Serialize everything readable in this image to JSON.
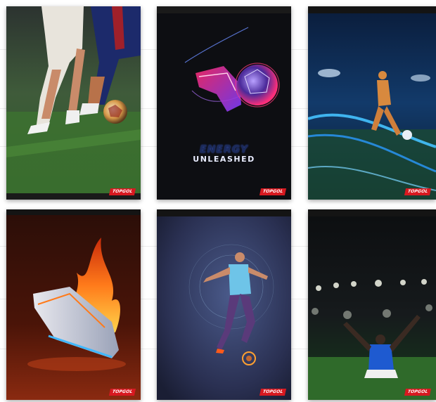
{
  "grid": {
    "covers": [
      {
        "scene": "players-dribbling",
        "brand": "TOPGOL"
      },
      {
        "scene": "neon-boot-and-ball",
        "brand": "TOPGOL",
        "headline_line1": "ENERGY",
        "headline_line2": "UNLEASHED"
      },
      {
        "scene": "night-stadium-kick",
        "brand": "TOPGOL"
      },
      {
        "scene": "flaming-boot",
        "brand": "TOPGOL"
      },
      {
        "scene": "wireframe-player",
        "brand": "TOPGOL"
      },
      {
        "scene": "celebrating-player",
        "brand": "TOPGOL"
      }
    ]
  },
  "colors": {
    "brand_red": "#d71920",
    "neon_blue": "#3fb7ff",
    "flame_orange": "#ff7a1a"
  }
}
